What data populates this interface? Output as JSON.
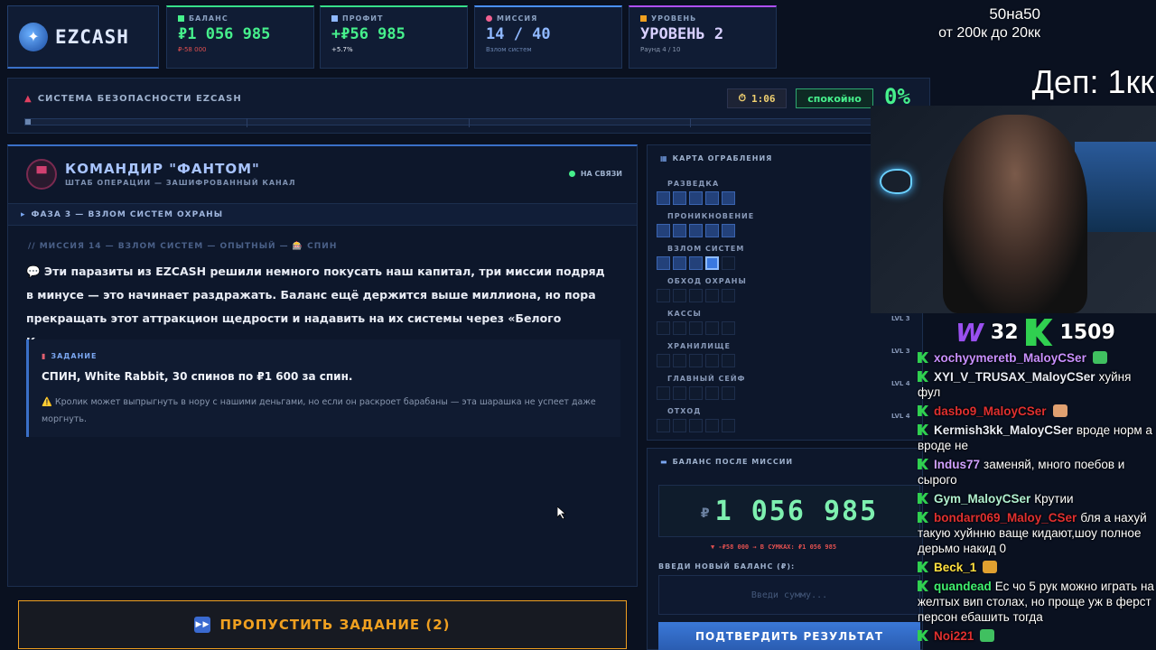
{
  "logo": {
    "text": "EZCASH"
  },
  "stats": [
    {
      "label": "БАЛАНС",
      "value": "₽1 056 985",
      "sub": "₽-58 000",
      "sub_color": "#e05050",
      "value_color": "#46f08c"
    },
    {
      "label": "ПРОФИТ",
      "value": "+₽56 985",
      "sub": "+5.7%",
      "sub_color": "#e8ecf5",
      "value_color": "#46f08c"
    },
    {
      "label": "МИССИЯ",
      "value": "14 / 40",
      "sub": "Взлом систем",
      "sub_color": "#6a84b0",
      "value_color": "#8fb8ff"
    },
    {
      "label": "УРОВЕНЬ",
      "value": "УРОВЕНЬ 2",
      "sub": "Раунд 4 / 10",
      "sub_color": "#8a98b0",
      "value_color": "#d8d0ff"
    }
  ],
  "overlay": {
    "line1": "50на50",
    "line2": "от 200к до 20кк",
    "deposit": "Деп: 1кк"
  },
  "security": {
    "title": "СИСТЕМА БЕЗОПАСНОСТИ EZCASH",
    "timer": "1:06",
    "status": "спокойно",
    "percent": "0%",
    "progress": 0.006
  },
  "commander": {
    "name": "КОМАНДИР \"ФАНТОМ\"",
    "subtitle": "ШТАБ ОПЕРАЦИИ — ЗАШИФРОВАННЫЙ КАНАЛ",
    "status": "НА СВЯЗИ",
    "phase": "ФАЗА 3 — ВЗЛОМ СИСТЕМ ОХРАНЫ",
    "mission_line": "// МИССИЯ 14 — ВЗЛОМ СИСТЕМ — ОПЫТНЫЙ — 🎰 СПИН",
    "message": "💬 Эти паразиты из EZCASH решили немного покусать наш капитал, три миссии подряд в минусе — это начинает раздражать. Баланс ещё держится выше миллиона, но пора прекращать этот аттракцион щедрости и надавить на их системы через «Белого Кролика».",
    "task_label": "ЗАДАНИЕ",
    "task": "СПИН, White Rabbit, 30 спинов по ₽1 600 за спин.",
    "warning": "⚠️ Кролик может выпрыгнуть в нору с нашими деньгами, но если он раскроет барабаны — эта шарашка не успеет даже моргнуть."
  },
  "skip_button": {
    "label": "ПРОПУСТИТЬ ЗАДАНИЕ (2)"
  },
  "heist_map": {
    "title": "КАРТА ОГРАБЛЕНИЯ",
    "stages": [
      {
        "name": "РАЗВЕДКА",
        "cells": [
          "done",
          "done",
          "done",
          "done",
          "done"
        ],
        "lvl": ""
      },
      {
        "name": "ПРОНИКНОВЕНИЕ",
        "cells": [
          "done",
          "done",
          "done",
          "done",
          "done"
        ],
        "lvl": ""
      },
      {
        "name": "ВЗЛОМ СИСТЕМ",
        "cells": [
          "done",
          "done",
          "done",
          "active",
          "empty"
        ],
        "lvl": ""
      },
      {
        "name": "ОБХОД ОХРАНЫ",
        "cells": [
          "empty",
          "empty",
          "empty",
          "empty",
          "empty"
        ],
        "lvl": ""
      },
      {
        "name": "КАССЫ",
        "cells": [
          "empty",
          "empty",
          "empty",
          "empty",
          "empty"
        ],
        "lvl": "LVL 3"
      },
      {
        "name": "ХРАНИЛИЩЕ",
        "cells": [
          "empty",
          "empty",
          "empty",
          "empty",
          "empty"
        ],
        "lvl": "LVL 3"
      },
      {
        "name": "ГЛАВНЫЙ СЕЙФ",
        "cells": [
          "empty",
          "empty",
          "empty",
          "empty",
          "empty"
        ],
        "lvl": "LVL 4"
      },
      {
        "name": "ОТХОД",
        "cells": [
          "empty",
          "empty",
          "empty",
          "empty",
          "empty"
        ],
        "lvl": "LVL 4"
      }
    ]
  },
  "balance_panel": {
    "title": "БАЛАНС ПОСЛЕ МИССИИ",
    "currency": "₽",
    "value": "1 056 985",
    "delta": "▼ -₽58 000 → В СУМКАХ: ₽1 056 985",
    "input_label": "ВВЕДИ НОВЫЙ БАЛАНС (₽):",
    "input_placeholder": "Введи сумму...",
    "confirm": "ПОДТВЕРДИТЬ РЕЗУЛЬТАТ"
  },
  "votes": {
    "w": "W",
    "w_count": "32",
    "k_count": "1509"
  },
  "chat": [
    {
      "user": "xochyymeretb_MaloyCSer",
      "text": "",
      "color": "#c890ff",
      "emote": "#40c060"
    },
    {
      "user": "XYI_V_TRUSAX_MaloyCSer",
      "text": "хуйня фул",
      "color": "#e8ecf5",
      "emote": ""
    },
    {
      "user": "dasbo9_MaloyCSer",
      "text": "",
      "color": "#e03030",
      "emote": "#e0a070"
    },
    {
      "user": "Kermish3kk_MaloyCSer",
      "text": "вроде норм а вроде не",
      "color": "#e8ecf5",
      "emote": ""
    },
    {
      "user": "Indus77",
      "text": "заменяй, много поебов и сырого",
      "color": "#d0a0ff",
      "emote": ""
    },
    {
      "user": "Gym_MaloyCSer",
      "text": "Крутии",
      "color": "#b0f0d0",
      "emote": ""
    },
    {
      "user": "bondarr069_Maloy_CSer",
      "text": "бля а нахуй такую хуйнню ваще кидают,шоу полное дерьмо накид 0",
      "color": "#e03030",
      "emote": ""
    },
    {
      "user": "Beck_1",
      "text": "",
      "color": "#ffe040",
      "emote": "#e0a030"
    },
    {
      "user": "quandead",
      "text": "Ес чо 5 рук можно играть на желтых вип столах, но проще уж в ферст персон ебашить тогда",
      "color": "#40f070",
      "emote": ""
    },
    {
      "user": "Noi221",
      "text": "",
      "color": "#e03030",
      "emote": "#40c060"
    }
  ]
}
